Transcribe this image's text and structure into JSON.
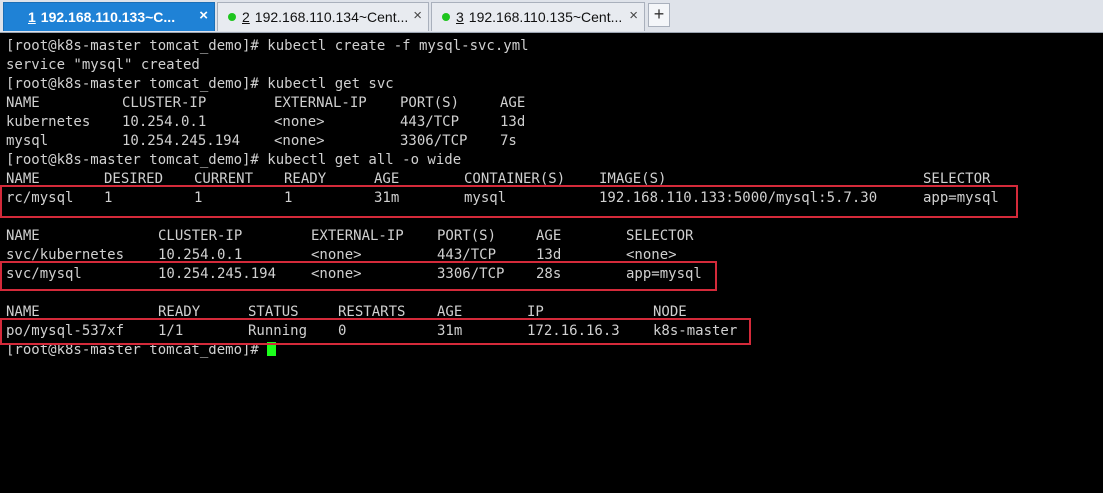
{
  "tabs": [
    {
      "num": "1",
      "title": "192.168.110.133~C...",
      "active": true
    },
    {
      "num": "2",
      "title": "192.168.110.134~Cent...",
      "active": false
    },
    {
      "num": "3",
      "title": "192.168.110.135~Cent...",
      "active": false
    }
  ],
  "new_tab_label": "+",
  "close_glyph": "×",
  "colors": {
    "accent": "#1f82d6",
    "highlight_box": "#d42a3a",
    "cursor": "#1cff1c",
    "terminal_bg": "#000000",
    "terminal_fg": "#d0d0d0"
  },
  "terminal": {
    "cmd1": "[root@k8s-master tomcat_demo]# kubectl create -f mysql-svc.yml",
    "out1": "service \"mysql\" created",
    "cmd2": "[root@k8s-master tomcat_demo]# kubectl get svc",
    "svc_header": [
      "NAME",
      "CLUSTER-IP",
      "EXTERNAL-IP",
      "PORT(S)",
      "AGE"
    ],
    "svc_rows": [
      [
        "kubernetes",
        "10.254.0.1",
        "<none>",
        "443/TCP",
        "13d"
      ],
      [
        "mysql",
        "10.254.245.194",
        "<none>",
        "3306/TCP",
        "7s"
      ]
    ],
    "cmd3": "[root@k8s-master tomcat_demo]# kubectl get all -o wide",
    "rc_header": [
      "NAME",
      "DESIRED",
      "CURRENT",
      "READY",
      "AGE",
      "CONTAINER(S)",
      "IMAGE(S)",
      "SELECTOR"
    ],
    "rc_row": [
      "rc/mysql",
      "1",
      "1",
      "1",
      "31m",
      "mysql",
      "192.168.110.133:5000/mysql:5.7.30",
      "app=mysql"
    ],
    "svc2_header": [
      "NAME",
      "CLUSTER-IP",
      "EXTERNAL-IP",
      "PORT(S)",
      "AGE",
      "SELECTOR"
    ],
    "svc2_rows": [
      [
        "svc/kubernetes",
        "10.254.0.1",
        "<none>",
        "443/TCP",
        "13d",
        "<none>"
      ],
      [
        "svc/mysql",
        "10.254.245.194",
        "<none>",
        "3306/TCP",
        "28s",
        "app=mysql"
      ]
    ],
    "po_header": [
      "NAME",
      "READY",
      "STATUS",
      "RESTARTS",
      "AGE",
      "IP",
      "NODE"
    ],
    "po_row": [
      "po/mysql-537xf",
      "1/1",
      "Running",
      "0",
      "31m",
      "172.16.16.3",
      "k8s-master"
    ],
    "prompt": "[root@k8s-master tomcat_demo]# "
  }
}
